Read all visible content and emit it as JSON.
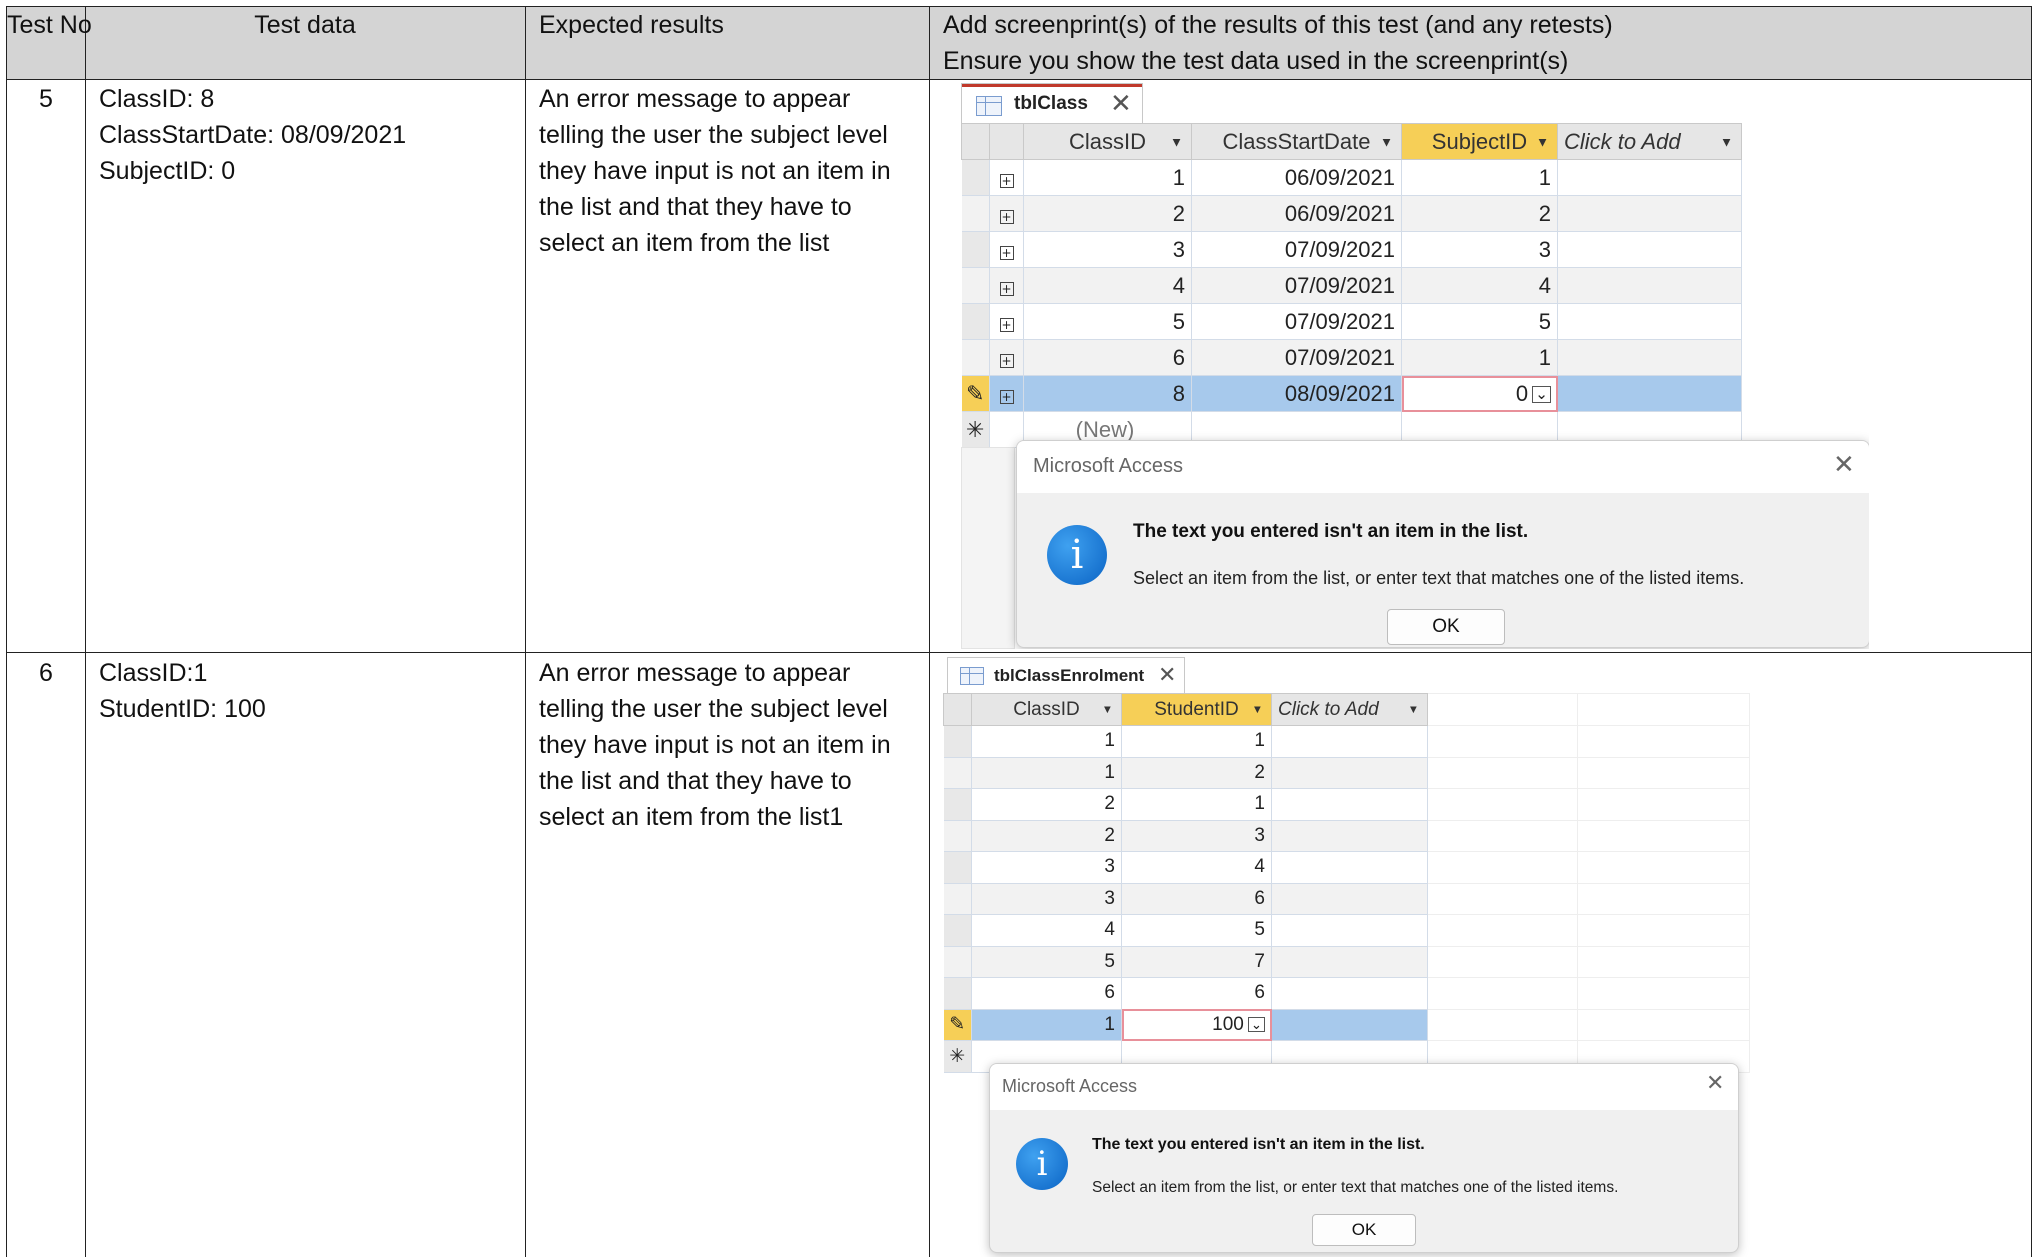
{
  "table": {
    "headers": {
      "test_no": "Test No",
      "test_data": "Test data",
      "expected": "Expected results",
      "screenprint_line1": "Add screenprint(s) of the results of this test (and any retests)",
      "screenprint_line2": "Ensure you show the test data used in the screenprint(s)"
    },
    "rows": [
      {
        "no": "5",
        "data": [
          "ClassID: 8",
          "ClassStartDate: 08/09/2021",
          "SubjectID: 0"
        ],
        "expected": "An error message to appear telling the user the subject level they have input is not an item in the list and that they have to select an item from the list"
      },
      {
        "no": "6",
        "data": [
          "ClassID:1",
          "StudentID: 100"
        ],
        "expected": "An error message to appear telling the user the subject level they have input is not an item in the list and that they have to select an item from the list1"
      }
    ]
  },
  "screenshot1": {
    "tab": "tblClass",
    "columns": [
      "ClassID",
      "ClassStartDate",
      "SubjectID",
      "Click to Add"
    ],
    "rows": [
      [
        "1",
        "06/09/2021",
        "1"
      ],
      [
        "2",
        "06/09/2021",
        "2"
      ],
      [
        "3",
        "07/09/2021",
        "3"
      ],
      [
        "4",
        "07/09/2021",
        "4"
      ],
      [
        "5",
        "07/09/2021",
        "5"
      ],
      [
        "6",
        "07/09/2021",
        "1"
      ],
      [
        "8",
        "08/09/2021",
        "0"
      ]
    ],
    "new_row": "(New)",
    "dialog": {
      "title": "Microsoft Access",
      "message": "The text you entered isn't an item in the list.",
      "detail": "Select an item from the list, or enter text that matches one of the listed items.",
      "ok": "OK"
    }
  },
  "screenshot2": {
    "tab": "tblClassEnrolment",
    "columns": [
      "ClassID",
      "StudentID",
      "Click to Add"
    ],
    "rows": [
      [
        "1",
        "1"
      ],
      [
        "1",
        "2"
      ],
      [
        "2",
        "1"
      ],
      [
        "2",
        "3"
      ],
      [
        "3",
        "4"
      ],
      [
        "3",
        "6"
      ],
      [
        "4",
        "5"
      ],
      [
        "5",
        "7"
      ],
      [
        "6",
        "6"
      ],
      [
        "1",
        "100"
      ]
    ],
    "dialog": {
      "title": "Microsoft Access",
      "message": "The text you entered isn't an item in the list.",
      "detail": "Select an item from the list, or enter text that matches one of the listed items.",
      "ok": "OK"
    }
  },
  "colors": {
    "header_bg": "#d4d4d4",
    "key_column": "#f6cf57",
    "active_row": "#a7c9ec",
    "tab_accent": "#c0392b"
  },
  "icons": [
    "grid-icon",
    "close-icon",
    "info-icon",
    "pencil-icon",
    "expand-icon",
    "dropdown-icon",
    "new-record-icon"
  ]
}
